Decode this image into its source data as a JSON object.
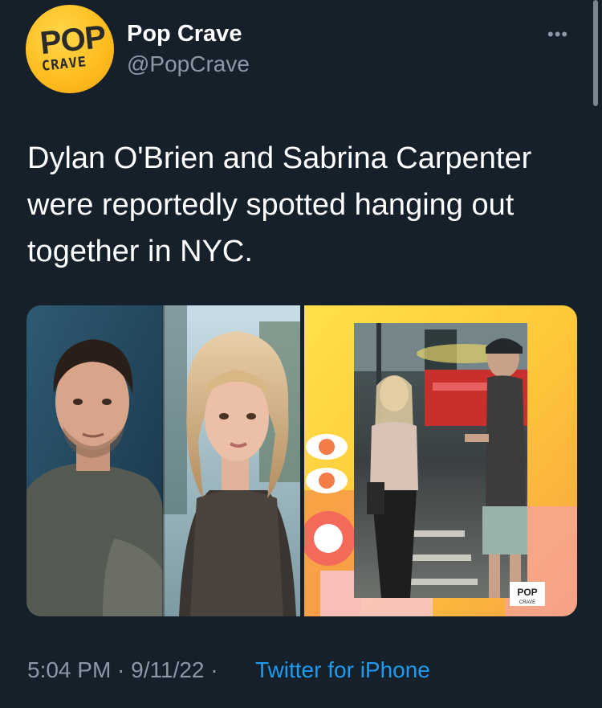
{
  "author": {
    "display_name": "Pop Crave",
    "handle": "@PopCrave",
    "avatar_text_top": "POP",
    "avatar_text_bottom": "CRAVE"
  },
  "menu_icon": "•••",
  "tweet": {
    "text": "Dylan O'Brien and Sabrina Carpenter were reportedly spotted hanging out together in NYC."
  },
  "media": {
    "watermark_top": "POP",
    "watermark_bottom": "CRAVE"
  },
  "meta": {
    "time_date": "5:04 PM · 9/11/22 · ",
    "source": "Twitter for iPhone"
  },
  "colors": {
    "background": "#15202b",
    "secondary_text": "#8b98a5",
    "link": "#1d9bf0",
    "avatar_yellow": "#ffbe22"
  }
}
